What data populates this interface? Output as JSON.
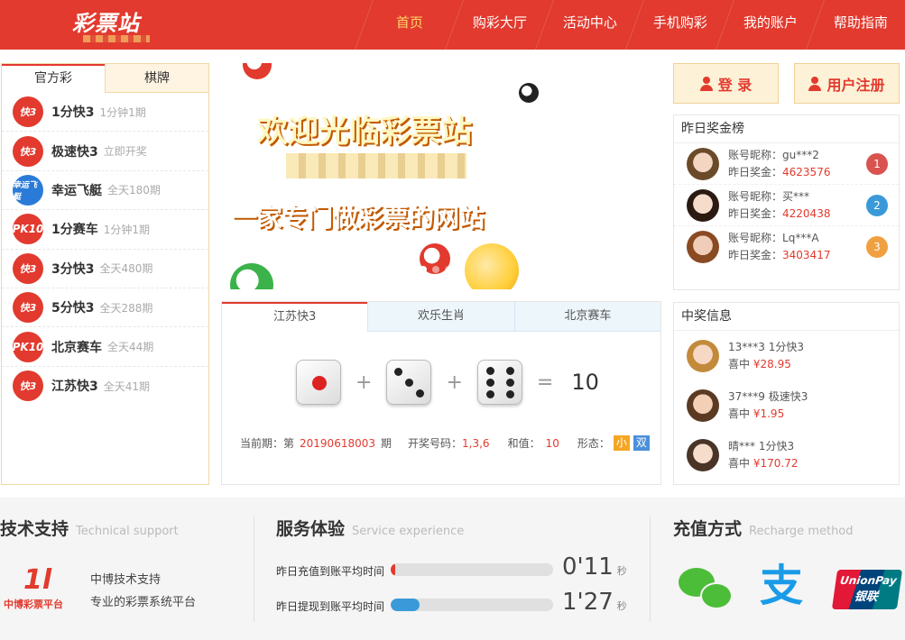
{
  "header": {
    "logo_text": "彩票站",
    "nav": [
      "首页",
      "购彩大厅",
      "活动中心",
      "手机购彩",
      "我的账户",
      "帮助指南"
    ]
  },
  "left_panel": {
    "tabs": [
      "官方彩",
      "棋牌"
    ],
    "games": [
      {
        "icon": "快3",
        "name": "1分快3",
        "sub": "1分钟1期"
      },
      {
        "icon": "快3",
        "name": "极速快3",
        "sub": "立即开奖"
      },
      {
        "icon": "幸运飞艇",
        "name": "幸运飞艇",
        "sub": "全天180期"
      },
      {
        "icon": "PK10",
        "name": "1分赛车",
        "sub": "1分钟1期"
      },
      {
        "icon": "快3",
        "name": "3分快3",
        "sub": "全天480期"
      },
      {
        "icon": "快3",
        "name": "5分快3",
        "sub": "全天288期"
      },
      {
        "icon": "PK10",
        "name": "北京赛车",
        "sub": "全天44期"
      },
      {
        "icon": "快3",
        "name": "江苏快3",
        "sub": "全天41期"
      }
    ]
  },
  "banner": {
    "title": "欢迎光临彩票站",
    "slogan": "一家专门做彩票的网站"
  },
  "lottery": {
    "tabs": [
      "江苏快3",
      "欢乐生肖",
      "北京赛车"
    ],
    "dice": [
      1,
      3,
      6
    ],
    "sum": "10",
    "plus": "+",
    "equals": "=",
    "period_label": "当前期：第",
    "period": "20190618003",
    "period_suffix": "期",
    "numbers_label": "开奖号码：",
    "numbers": "1,3,6",
    "sum_label": "和值：",
    "sum_value": "10",
    "form_label": "形态：",
    "form_tags": [
      {
        "text": "小",
        "color": "#f5a623"
      },
      {
        "text": "双",
        "color": "#4a90d9"
      }
    ]
  },
  "auth": {
    "login": "登 录",
    "register": "用户注册"
  },
  "ranking": {
    "title": "昨日奖金榜",
    "name_label": "账号昵称：",
    "amount_label": "昨日奖金：",
    "items": [
      {
        "name": "gu***2",
        "amount": "4623576",
        "rank": "1",
        "color": "#d9534f"
      },
      {
        "name": "买***",
        "amount": "4220438",
        "rank": "2",
        "color": "#3a9ad9"
      },
      {
        "name": "Lq***A",
        "amount": "3403417",
        "rank": "3",
        "color": "#f0a040"
      }
    ]
  },
  "winners": {
    "title": "中奖信息",
    "win_label": "喜中",
    "items": [
      {
        "user": "13***3",
        "game": "1分快3",
        "amount": "¥28.95"
      },
      {
        "user": "37***9",
        "game": "极速快3",
        "amount": "¥1.95"
      },
      {
        "user": "晴***",
        "game": "1分快3",
        "amount": "¥170.72"
      }
    ]
  },
  "footer": {
    "support_title": "技术支持",
    "support_en": "Technical support",
    "support_logo": "中博彩票平台",
    "support_line1": "中博技术支持",
    "support_line2": "专业的彩票系统平台",
    "service_title": "服务体验",
    "service_en": "Service experience",
    "deposit_label": "昨日充值到账平均时间",
    "deposit_time": "0'11",
    "deposit_fraction": 0.03,
    "withdraw_label": "昨日提现到账平均时间",
    "withdraw_time": "1'27",
    "withdraw_fraction": 0.18,
    "sec_unit": "秒",
    "recharge_title": "充值方式",
    "recharge_en": "Recharge method",
    "unionpay": "UnionPay",
    "unionpay_cn": "银联",
    "alipay_glyph": "支"
  }
}
